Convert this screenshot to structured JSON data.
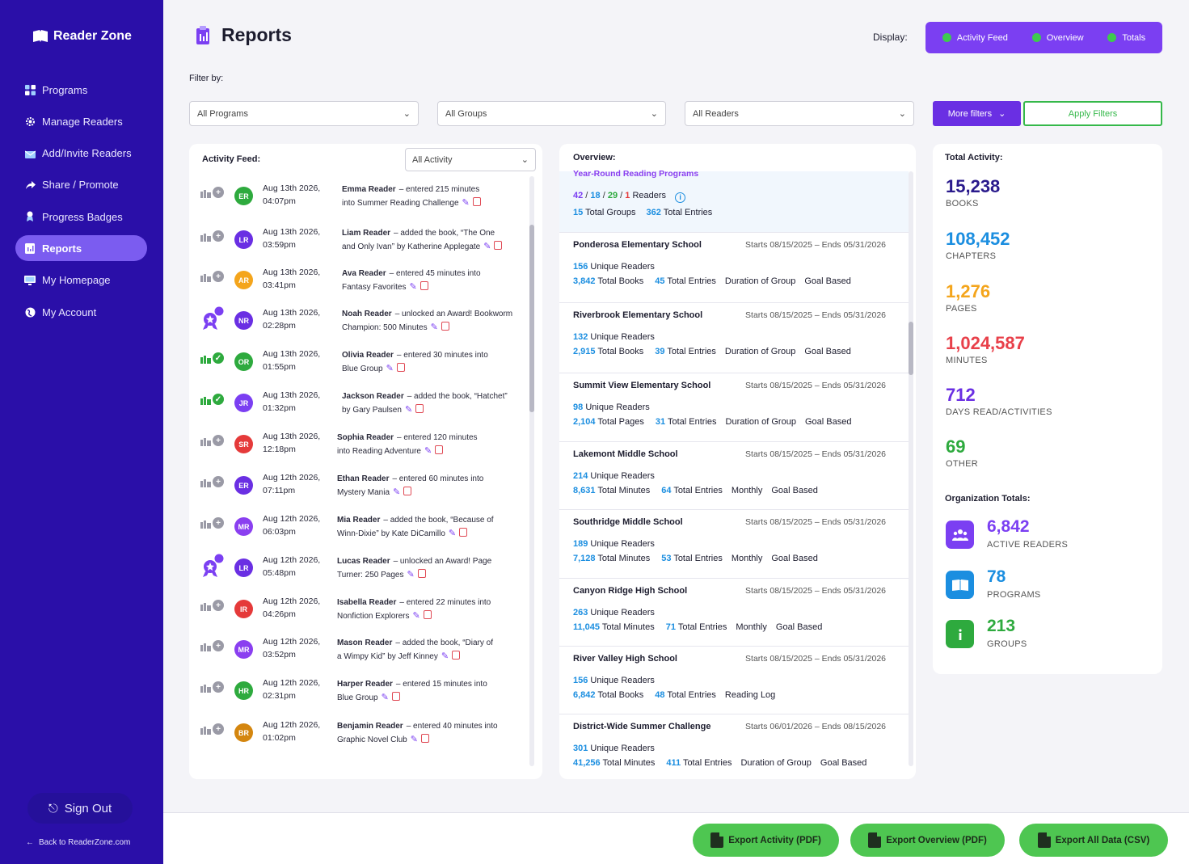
{
  "app": {
    "name": "Reader Zone"
  },
  "sidebar": {
    "items": [
      {
        "label": "Programs",
        "icon": "grid-icon",
        "active": false
      },
      {
        "label": "Manage Readers",
        "icon": "gear-icon",
        "active": false
      },
      {
        "label": "Add/Invite Readers",
        "icon": "mail-icon",
        "active": false
      },
      {
        "label": "Share / Promote",
        "icon": "share-icon",
        "active": false
      },
      {
        "label": "Progress Badges",
        "icon": "badge-icon",
        "active": false
      },
      {
        "label": "Reports",
        "icon": "report-icon",
        "active": true
      },
      {
        "label": "My Homepage",
        "icon": "monitor-icon",
        "active": false
      },
      {
        "label": "My Account",
        "icon": "globe-icon",
        "active": false
      }
    ],
    "sign_out": "Sign Out",
    "back_link": "Back to ReaderZone.com"
  },
  "header": {
    "title": "Reports",
    "display_label": "Display:",
    "display_options": [
      "Activity Feed",
      "Overview",
      "Totals"
    ]
  },
  "filters": {
    "label": "Filter by:",
    "programs": "All Programs",
    "groups": "All Groups",
    "readers": "All Readers",
    "more": "More filters",
    "apply": "Apply Filters"
  },
  "activity": {
    "title": "Activity Feed:",
    "filter": "All Activity",
    "rows": [
      {
        "kind": "plus",
        "initials": "ER",
        "color": "#2eaa3e",
        "date": "Aug 13th 2026,",
        "time": "04:07pm",
        "name": "Emma Reader",
        "text": "– entered 215 minutes",
        "text2": "into Summer Reading Challenge"
      },
      {
        "kind": "plus",
        "initials": "LR",
        "color": "#6a2fe3",
        "date": "Aug 13th 2026,",
        "time": "03:59pm",
        "name": "Liam Reader",
        "text": "– added the book, “The One",
        "text2": "and Only Ivan” by Katherine Applegate"
      },
      {
        "kind": "plus",
        "initials": "AR",
        "color": "#f4a51c",
        "date": "Aug 13th 2026,",
        "time": "03:41pm",
        "name": "Ava Reader",
        "text": "– entered 45 minutes into",
        "text2": "Fantasy Favorites"
      },
      {
        "kind": "award",
        "initials": "NR",
        "color": "#6a2fe3",
        "date": "Aug 13th 2026,",
        "time": "02:28pm",
        "name": "Noah Reader",
        "text": "– unlocked an Award! Bookworm",
        "text2": "Champion: 500 Minutes"
      },
      {
        "kind": "check",
        "initials": "OR",
        "color": "#2eaa3e",
        "date": "Aug 13th 2026,",
        "time": "01:55pm",
        "name": "Olivia Reader",
        "text": "– entered 30 minutes into",
        "text2": "Blue Group"
      },
      {
        "kind": "check",
        "initials": "JR",
        "color": "#7b3ff2",
        "date": "Aug 13th 2026,",
        "time": "01:32pm",
        "name": "Jackson Reader",
        "text": "– added the book, “Hatchet”",
        "text2": "by Gary Paulsen"
      },
      {
        "kind": "plus",
        "initials": "SR",
        "color": "#e53a3a",
        "date": "Aug 13th 2026,",
        "time": "12:18pm",
        "name": "Sophia Reader",
        "text": "– entered 120 minutes",
        "text2": "into Reading Adventure"
      },
      {
        "kind": "plus",
        "initials": "ER",
        "color": "#6a2fe3",
        "date": "Aug 12th 2026,",
        "time": "07:11pm",
        "name": "Ethan Reader",
        "text": "– entered 60 minutes into",
        "text2": "Mystery Mania"
      },
      {
        "kind": "plus",
        "initials": "MR",
        "color": "#8a3ff0",
        "date": "Aug 12th 2026,",
        "time": "06:03pm",
        "name": "Mia Reader",
        "text": "– added the book, “Because of",
        "text2": "Winn-Dixie” by Kate DiCamillo"
      },
      {
        "kind": "award",
        "initials": "LR",
        "color": "#6a2fe3",
        "date": "Aug 12th 2026,",
        "time": "05:48pm",
        "name": "Lucas Reader",
        "text": "– unlocked an Award! Page",
        "text2": "Turner: 250 Pages"
      },
      {
        "kind": "plus",
        "initials": "IR",
        "color": "#e53a3a",
        "date": "Aug 12th 2026,",
        "time": "04:26pm",
        "name": "Isabella Reader",
        "text": "– entered 22 minutes into",
        "text2": "Nonfiction Explorers"
      },
      {
        "kind": "plus",
        "initials": "MR",
        "color": "#8a3ff0",
        "date": "Aug 12th 2026,",
        "time": "03:52pm",
        "name": "Mason Reader",
        "text": "– added the book, “Diary of",
        "text2": "a Wimpy Kid” by Jeff Kinney"
      },
      {
        "kind": "plus",
        "initials": "HR",
        "color": "#2eaa3e",
        "date": "Aug 12th 2026,",
        "time": "02:31pm",
        "name": "Harper Reader",
        "text": "– entered 15 minutes into",
        "text2": "Blue Group"
      },
      {
        "kind": "plus",
        "initials": "BR",
        "color": "#d4860f",
        "date": "Aug 12th 2026,",
        "time": "01:02pm",
        "name": "Benjamin Reader",
        "text": "– entered 40 minutes into",
        "text2": "Graphic Novel Club"
      }
    ]
  },
  "overview": {
    "title": "Overview:",
    "summary": {
      "heading": "Year-Round Reading Programs",
      "n1": "42",
      "n2": "18",
      "n3": "29",
      "n4": "1",
      "readers_label": "Readers",
      "groups": "15",
      "groups_label": "Total Groups",
      "entries": "362",
      "entries_label": "Total Entries"
    },
    "items": [
      {
        "name": "Ponderosa Elementary School",
        "dates": "Starts 08/15/2025  –  Ends 05/31/2026",
        "unique": "156",
        "unique_label": "Unique Readers",
        "total": "3,842",
        "total_label": "Total Books",
        "entries": "45",
        "entries_label": "Total Entries",
        "tag1": "Duration of Group",
        "tag2": "Goal Based"
      },
      {
        "name": "Riverbrook Elementary School",
        "dates": "Starts 08/15/2025  –  Ends 05/31/2026",
        "unique": "132",
        "unique_label": "Unique Readers",
        "total": "2,915",
        "total_label": "Total Books",
        "entries": "39",
        "entries_label": "Total Entries",
        "tag1": "Duration of Group",
        "tag2": "Goal Based"
      },
      {
        "name": "Summit View Elementary School",
        "dates": "Starts 08/15/2025  –  Ends 05/31/2026",
        "unique": "98",
        "unique_label": "Unique Readers",
        "total": "2,104",
        "total_label": "Total Pages",
        "entries": "31",
        "entries_label": "Total Entries",
        "tag1": "Duration of Group",
        "tag2": "Goal Based"
      },
      {
        "name": "Lakemont Middle School",
        "dates": "Starts 08/15/2025  –  Ends 05/31/2026",
        "unique": "214",
        "unique_label": "Unique Readers",
        "total": "8,631",
        "total_label": "Total Minutes",
        "entries": "64",
        "entries_label": "Total Entries",
        "tag1": "Monthly",
        "tag2": "Goal Based"
      },
      {
        "name": "Southridge Middle School",
        "dates": "Starts 08/15/2025  –  Ends 05/31/2026",
        "unique": "189",
        "unique_label": "Unique Readers",
        "total": "7,128",
        "total_label": "Total Minutes",
        "entries": "53",
        "entries_label": "Total Entries",
        "tag1": "Monthly",
        "tag2": "Goal Based"
      },
      {
        "name": "Canyon Ridge High School",
        "dates": "Starts 08/15/2025  –  Ends 05/31/2026",
        "unique": "263",
        "unique_label": "Unique Readers",
        "total": "11,045",
        "total_label": "Total Minutes",
        "entries": "71",
        "entries_label": "Total Entries",
        "tag1": "Monthly",
        "tag2": "Goal Based"
      },
      {
        "name": "River Valley High School",
        "dates": "Starts 08/15/2025  –  Ends 05/31/2026",
        "unique": "156",
        "unique_label": "Unique Readers",
        "total": "6,842",
        "total_label": "Total Books",
        "entries": "48",
        "entries_label": "Total Entries",
        "tag1": "Reading Log",
        "tag2": ""
      },
      {
        "name": "District-Wide Summer Challenge",
        "dates": "Starts 06/01/2026  –  Ends 08/15/2026",
        "unique": "301",
        "unique_label": "Unique Readers",
        "total": "41,256",
        "total_label": "Total Minutes",
        "entries": "411",
        "entries_label": "Total Entries",
        "tag1": "Duration of Group",
        "tag2": "Goal Based"
      }
    ]
  },
  "totals": {
    "title": "Total Activity:",
    "items": [
      {
        "value": "15,238",
        "label": "BOOKS",
        "color": "#2a1a8c"
      },
      {
        "value": "108,452",
        "label": "CHAPTERS",
        "color": "#1b8ee0"
      },
      {
        "value": "1,276",
        "label": "PAGES",
        "color": "#f4a51c"
      },
      {
        "value": "1,024,587",
        "label": "MINUTES",
        "color": "#e8404a"
      },
      {
        "value": "712",
        "label": "DAYS READ/ACTIVITIES",
        "color": "#6a2fe3"
      },
      {
        "value": "69",
        "label": "OTHER",
        "color": "#2eaa3e"
      }
    ],
    "org_title": "Organization Totals:",
    "org": [
      {
        "value": "6,842",
        "label": "ACTIVE READERS",
        "color": "#7b3ff2",
        "icon": "users-icon"
      },
      {
        "value": "78",
        "label": "PROGRAMS",
        "color": "#1b8ee0",
        "icon": "book-icon"
      },
      {
        "value": "213",
        "label": "GROUPS",
        "color": "#2eaa3e",
        "icon": "info-icon"
      }
    ]
  },
  "footer": {
    "export_activity": "Export Activity (PDF)",
    "export_overview": "Export Overview (PDF)",
    "export_all": "Export All Data (CSV)"
  }
}
